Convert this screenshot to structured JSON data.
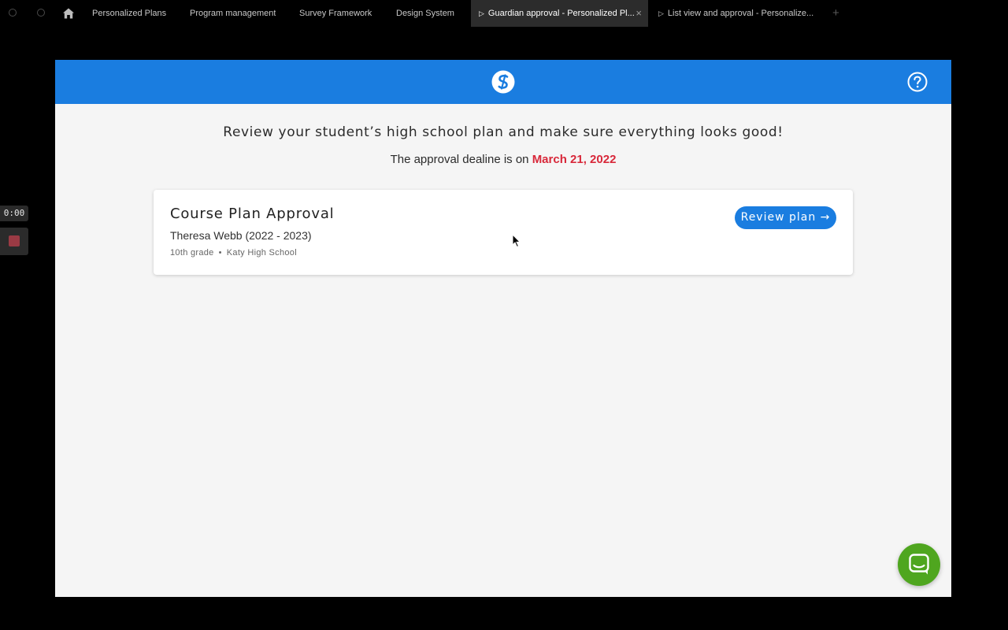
{
  "tabs": [
    {
      "label": "Personalized Plans"
    },
    {
      "label": "Program management"
    },
    {
      "label": "Survey Framework"
    },
    {
      "label": "Design System"
    },
    {
      "label": "Guardian approval - Personalized Pl...",
      "active": true
    },
    {
      "label": "List view and approval - Personalize..."
    }
  ],
  "tab_add": "+",
  "tab_close": "×",
  "recorder": {
    "time": "0:00"
  },
  "app": {
    "intro": "Review your student’s high school plan and make sure everything looks good!",
    "deadline_prefix": "The approval dealine is on",
    "deadline_date": "March 21, 2022",
    "card": {
      "title": "Course Plan Approval",
      "student": "Theresa Webb (2022 - 2023)",
      "grade": "10th grade",
      "separator": "•",
      "school": "Katy High School",
      "button": "Review plan →"
    }
  },
  "colors": {
    "brand_blue": "#1a7de0",
    "deadline_red": "#d8283a",
    "chat_green": "#4fa61f"
  },
  "icons": {
    "home": "home-icon",
    "logo": "logo-icon",
    "help": "help-icon",
    "chat": "chat-icon"
  }
}
